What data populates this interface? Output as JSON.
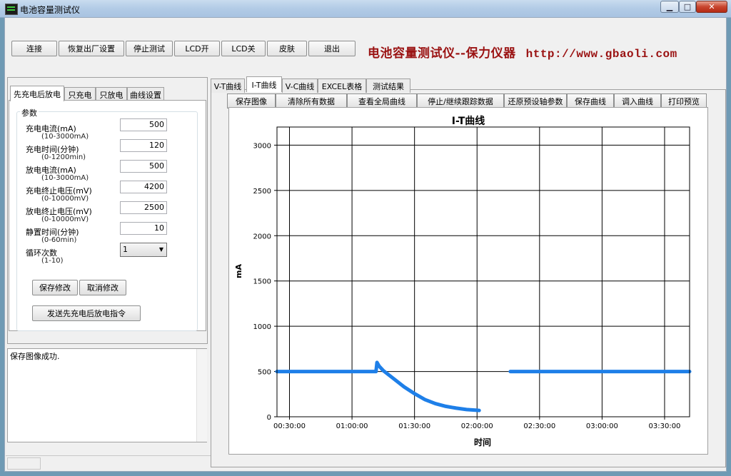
{
  "window": {
    "title": "电池容量测试仪",
    "minimize": "▁",
    "maximize": "□",
    "close": "✕",
    "icon": "battery-app-icon"
  },
  "toolbar": {
    "buttons": [
      "连接",
      "恢复出厂设置",
      "停止测试",
      "LCD开",
      "LCD关",
      "皮肤",
      "退出"
    ],
    "brand": "电池容量测试仪--保力仪器",
    "url": "http://www.gbaoli.com"
  },
  "left_tabs": [
    "先充电后放电",
    "只充电",
    "只放电",
    "曲线设置"
  ],
  "params": {
    "group_title": "参数",
    "rows": [
      {
        "label": "充电电流(mA)",
        "hint": "(10-3000mA)",
        "value": "500"
      },
      {
        "label": "充电时间(分钟)",
        "hint": "(0-1200min)",
        "value": "120"
      },
      {
        "label": "放电电流(mA)",
        "hint": "(10-3000mA)",
        "value": "500"
      },
      {
        "label": "充电终止电压(mV)",
        "hint": "(0-10000mV)",
        "value": "4200"
      },
      {
        "label": "放电终止电压(mV)",
        "hint": "(0-10000mV)",
        "value": "2500"
      },
      {
        "label": "静置时间(分钟)",
        "hint": "(0-60min)",
        "value": "10"
      }
    ],
    "cycle_label": "循环次数",
    "cycle_hint": "(1-10)",
    "cycle_value": "1",
    "save_label": "保存修改",
    "cancel_label": "取消修改",
    "send_label": "发送先充电后放电指令"
  },
  "log": {
    "message": "保存图像成功."
  },
  "right_tabs": [
    "V-T曲线",
    "I-T曲线",
    "V-C曲线",
    "EXCEL表格",
    "测试结果"
  ],
  "chart_buttons": [
    "保存图像",
    "清除所有数据",
    "查看全局曲线",
    "停止/继续跟踪数据",
    "还原预设轴参数",
    "保存曲线",
    "调入曲线",
    "打印预览"
  ],
  "colors": {
    "series": "#1e7fe8",
    "brand": "#9a1212"
  },
  "chart_data": {
    "type": "line",
    "title": "I-T曲线",
    "xlabel": "时间",
    "ylabel": "mA",
    "ylim": [
      0,
      3200
    ],
    "y_ticks": [
      0,
      500,
      1000,
      1500,
      2000,
      2500,
      3000
    ],
    "y_tick_labels": [
      "0",
      "500",
      "1000",
      "1500",
      "2000",
      "2500",
      "3000"
    ],
    "x_ticks_min": [
      30,
      60,
      90,
      120,
      150,
      180,
      210
    ],
    "x_tick_labels": [
      "00:30:00",
      "01:00:00",
      "01:30:00",
      "02:00:00",
      "02:30:00",
      "03:00:00",
      "03:30:00"
    ],
    "xlim_min": [
      24,
      222
    ],
    "grid": true,
    "series": [
      {
        "x_min": [
          24,
          40,
          60,
          70,
          71.5,
          72,
          73,
          75,
          80,
          85,
          90,
          95,
          100,
          105,
          110,
          115,
          120,
          121
        ],
        "values": [
          500,
          500,
          500,
          500,
          500,
          600,
          560,
          510,
          420,
          330,
          255,
          190,
          145,
          115,
          95,
          80,
          72,
          70
        ]
      },
      {
        "x_min": [
          136,
          160,
          190,
          222
        ],
        "values": [
          500,
          500,
          500,
          500
        ]
      }
    ]
  }
}
